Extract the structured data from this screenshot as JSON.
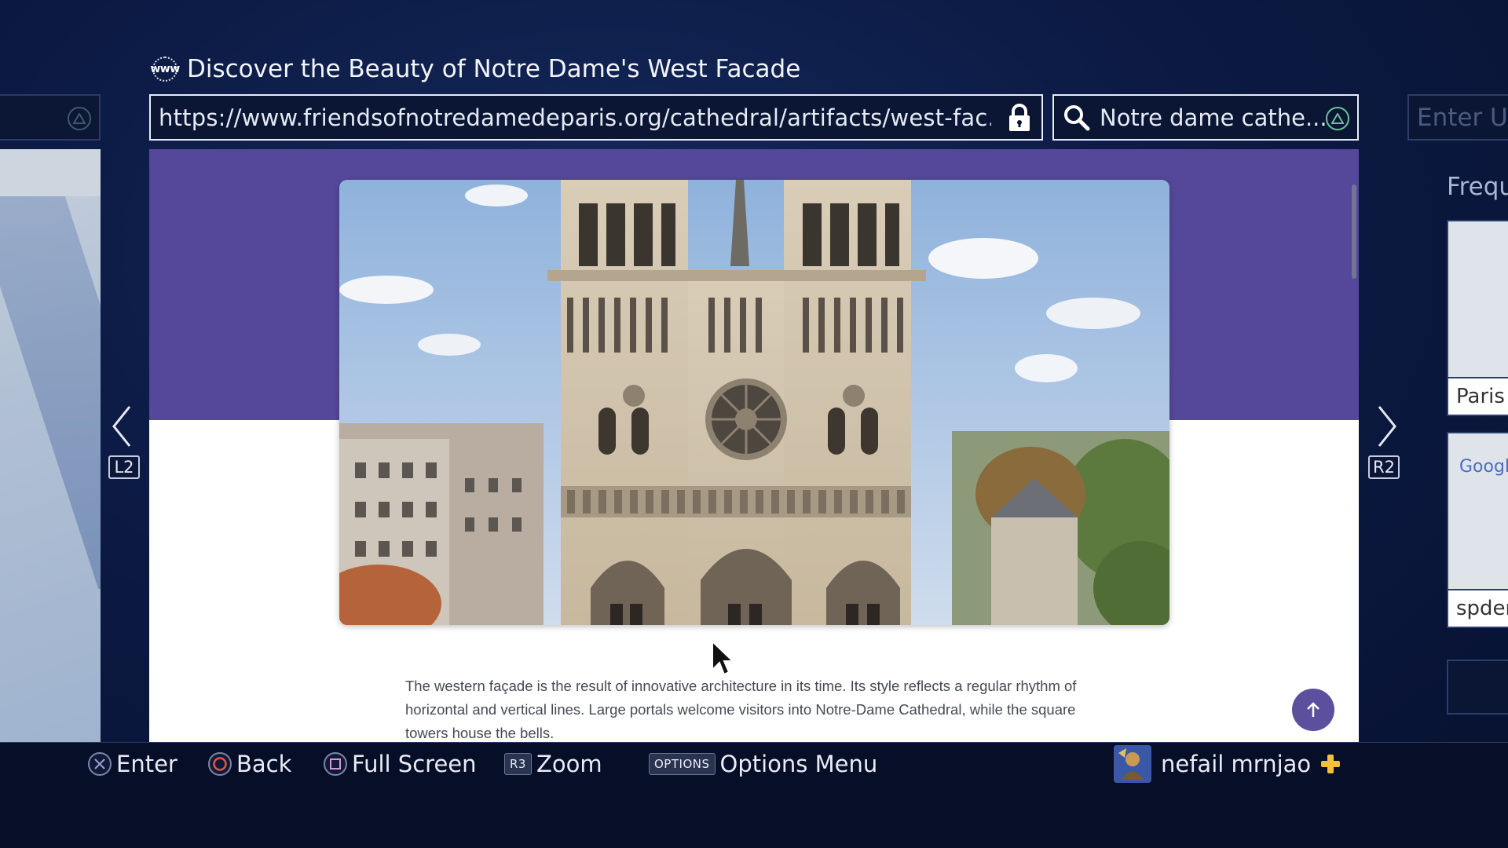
{
  "browser": {
    "page_title": "Discover the Beauty of Notre Dame's West Facade",
    "www_icon_label": "www",
    "url": "https://www.friendsofnotredamedeparis.org/cathedral/artifacts/west-fac...",
    "search_query": "Notre dame cathe..."
  },
  "right_card": {
    "url_placeholder": "Enter UR",
    "heading": "Frequ",
    "tiles": [
      {
        "label": "Paris I"
      },
      {
        "label": "spder",
        "logo_text": "Google"
      }
    ]
  },
  "article": {
    "body": "The western façade is the result of innovative architecture in its time. Its style reflects a regular rhythm of horizontal and vertical lines. Large portals welcome visitors into Notre-Dame Cathedral, while the square towers house the bells."
  },
  "nav": {
    "left_button": "L2",
    "right_button": "R2"
  },
  "controls": {
    "enter": "Enter",
    "back": "Back",
    "fullscreen": "Full Screen",
    "zoom_key": "R3",
    "zoom": "Zoom",
    "options_key": "OPTIONS",
    "options": "Options Menu"
  },
  "user": {
    "name": "nefail mrnjao"
  },
  "colors": {
    "background": "#0c1b45",
    "hero_band": "#55489a",
    "scroll_top_button": "#5b4f9e",
    "plus_gold": "#f2c23a"
  }
}
